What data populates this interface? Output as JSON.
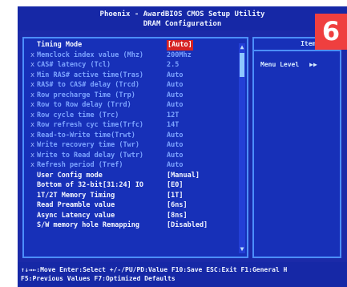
{
  "bios": {
    "title_line_1": "Phoenix - AwardBIOS CMOS Setup Utility",
    "title_line_2": "DRAM Configuration"
  },
  "rows": [
    {
      "marker": "",
      "label": "Timing Mode",
      "value": "[Auto]"
    },
    {
      "marker": "x",
      "label": "Memclock index value (Mhz)",
      "value": "200Mhz"
    },
    {
      "marker": "x",
      "label": "CAS# latency (Tcl)",
      "value": "2.5"
    },
    {
      "marker": "x",
      "label": "Min RAS# active time(Tras)",
      "value": "Auto"
    },
    {
      "marker": "x",
      "label": "RAS# to CAS# delay   (Trcd)",
      "value": "Auto"
    },
    {
      "marker": "x",
      "label": "Row precharge Time   (Trp)",
      "value": "Auto"
    },
    {
      "marker": "x",
      "label": "Row to Row delay     (Trrd)",
      "value": "Auto"
    },
    {
      "marker": "x",
      "label": "Row cycle time       (Trc)",
      "value": "12T"
    },
    {
      "marker": "x",
      "label": "Row refresh cyc time(Trfc)",
      "value": "14T"
    },
    {
      "marker": "x",
      "label": "Read-to-Write time(Trwt)",
      "value": "Auto"
    },
    {
      "marker": "x",
      "label": "Write recovery time (Twr)",
      "value": "Auto"
    },
    {
      "marker": "x",
      "label": "Write to Read delay (Twtr)",
      "value": "Auto"
    },
    {
      "marker": "x",
      "label": "Refresh period       (Tref)",
      "value": "Auto"
    },
    {
      "marker": "",
      "label": "User Config mode",
      "value": "[Manual]"
    },
    {
      "marker": "",
      "label": "Bottom of 32-bit[31:24] IO",
      "value": "[E0]"
    },
    {
      "marker": "",
      "label": "1T/2T Memory Timing",
      "value": "[1T]"
    },
    {
      "marker": "",
      "label": "Read Preamble value",
      "value": "[6ns]"
    },
    {
      "marker": "",
      "label": "Async Latency value",
      "value": "[8ns]"
    },
    {
      "marker": "",
      "label": "S/W memory hole Remapping",
      "value": "[Disabled]"
    }
  ],
  "help": {
    "header": "Item H",
    "menu_level_label": "Menu Level",
    "menu_level_arrows": "▶▶"
  },
  "scrollbar": {
    "up_arrow": "▲",
    "down_arrow": "▼"
  },
  "footer": {
    "line_1": "↑↓→←:Move  Enter:Select  +/-/PU/PD:Value  F10:Save  ESC:Exit  F1:General H",
    "line_2": "F5:Previous Values              F7:Optimized Defaults"
  },
  "badge": {
    "text": "6"
  },
  "colors": {
    "bios_blue": "#1b2aa8",
    "border_blue": "#4c8fff",
    "dim_text": "#7ba3ff",
    "bright_text": "#f4f7ff",
    "highlight": "#d62323",
    "badge_red": "#ef3f3f"
  },
  "icons": {
    "scroll_up": "scroll-up-arrow-icon",
    "scroll_down": "scroll-down-arrow-icon",
    "menu_arrows": "double-right-arrow-icon"
  }
}
